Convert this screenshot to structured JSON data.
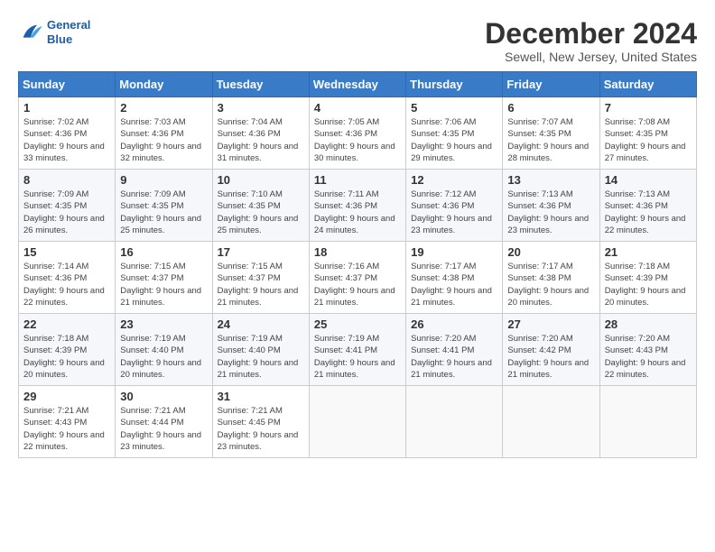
{
  "logo": {
    "line1": "General",
    "line2": "Blue"
  },
  "title": "December 2024",
  "subtitle": "Sewell, New Jersey, United States",
  "weekdays": [
    "Sunday",
    "Monday",
    "Tuesday",
    "Wednesday",
    "Thursday",
    "Friday",
    "Saturday"
  ],
  "weeks": [
    [
      {
        "day": "1",
        "sunrise": "7:02 AM",
        "sunset": "4:36 PM",
        "daylight": "9 hours and 33 minutes."
      },
      {
        "day": "2",
        "sunrise": "7:03 AM",
        "sunset": "4:36 PM",
        "daylight": "9 hours and 32 minutes."
      },
      {
        "day": "3",
        "sunrise": "7:04 AM",
        "sunset": "4:36 PM",
        "daylight": "9 hours and 31 minutes."
      },
      {
        "day": "4",
        "sunrise": "7:05 AM",
        "sunset": "4:36 PM",
        "daylight": "9 hours and 30 minutes."
      },
      {
        "day": "5",
        "sunrise": "7:06 AM",
        "sunset": "4:35 PM",
        "daylight": "9 hours and 29 minutes."
      },
      {
        "day": "6",
        "sunrise": "7:07 AM",
        "sunset": "4:35 PM",
        "daylight": "9 hours and 28 minutes."
      },
      {
        "day": "7",
        "sunrise": "7:08 AM",
        "sunset": "4:35 PM",
        "daylight": "9 hours and 27 minutes."
      }
    ],
    [
      {
        "day": "8",
        "sunrise": "7:09 AM",
        "sunset": "4:35 PM",
        "daylight": "9 hours and 26 minutes."
      },
      {
        "day": "9",
        "sunrise": "7:09 AM",
        "sunset": "4:35 PM",
        "daylight": "9 hours and 25 minutes."
      },
      {
        "day": "10",
        "sunrise": "7:10 AM",
        "sunset": "4:35 PM",
        "daylight": "9 hours and 25 minutes."
      },
      {
        "day": "11",
        "sunrise": "7:11 AM",
        "sunset": "4:36 PM",
        "daylight": "9 hours and 24 minutes."
      },
      {
        "day": "12",
        "sunrise": "7:12 AM",
        "sunset": "4:36 PM",
        "daylight": "9 hours and 23 minutes."
      },
      {
        "day": "13",
        "sunrise": "7:13 AM",
        "sunset": "4:36 PM",
        "daylight": "9 hours and 23 minutes."
      },
      {
        "day": "14",
        "sunrise": "7:13 AM",
        "sunset": "4:36 PM",
        "daylight": "9 hours and 22 minutes."
      }
    ],
    [
      {
        "day": "15",
        "sunrise": "7:14 AM",
        "sunset": "4:36 PM",
        "daylight": "9 hours and 22 minutes."
      },
      {
        "day": "16",
        "sunrise": "7:15 AM",
        "sunset": "4:37 PM",
        "daylight": "9 hours and 21 minutes."
      },
      {
        "day": "17",
        "sunrise": "7:15 AM",
        "sunset": "4:37 PM",
        "daylight": "9 hours and 21 minutes."
      },
      {
        "day": "18",
        "sunrise": "7:16 AM",
        "sunset": "4:37 PM",
        "daylight": "9 hours and 21 minutes."
      },
      {
        "day": "19",
        "sunrise": "7:17 AM",
        "sunset": "4:38 PM",
        "daylight": "9 hours and 21 minutes."
      },
      {
        "day": "20",
        "sunrise": "7:17 AM",
        "sunset": "4:38 PM",
        "daylight": "9 hours and 20 minutes."
      },
      {
        "day": "21",
        "sunrise": "7:18 AM",
        "sunset": "4:39 PM",
        "daylight": "9 hours and 20 minutes."
      }
    ],
    [
      {
        "day": "22",
        "sunrise": "7:18 AM",
        "sunset": "4:39 PM",
        "daylight": "9 hours and 20 minutes."
      },
      {
        "day": "23",
        "sunrise": "7:19 AM",
        "sunset": "4:40 PM",
        "daylight": "9 hours and 20 minutes."
      },
      {
        "day": "24",
        "sunrise": "7:19 AM",
        "sunset": "4:40 PM",
        "daylight": "9 hours and 21 minutes."
      },
      {
        "day": "25",
        "sunrise": "7:19 AM",
        "sunset": "4:41 PM",
        "daylight": "9 hours and 21 minutes."
      },
      {
        "day": "26",
        "sunrise": "7:20 AM",
        "sunset": "4:41 PM",
        "daylight": "9 hours and 21 minutes."
      },
      {
        "day": "27",
        "sunrise": "7:20 AM",
        "sunset": "4:42 PM",
        "daylight": "9 hours and 21 minutes."
      },
      {
        "day": "28",
        "sunrise": "7:20 AM",
        "sunset": "4:43 PM",
        "daylight": "9 hours and 22 minutes."
      }
    ],
    [
      {
        "day": "29",
        "sunrise": "7:21 AM",
        "sunset": "4:43 PM",
        "daylight": "9 hours and 22 minutes."
      },
      {
        "day": "30",
        "sunrise": "7:21 AM",
        "sunset": "4:44 PM",
        "daylight": "9 hours and 23 minutes."
      },
      {
        "day": "31",
        "sunrise": "7:21 AM",
        "sunset": "4:45 PM",
        "daylight": "9 hours and 23 minutes."
      },
      null,
      null,
      null,
      null
    ]
  ]
}
